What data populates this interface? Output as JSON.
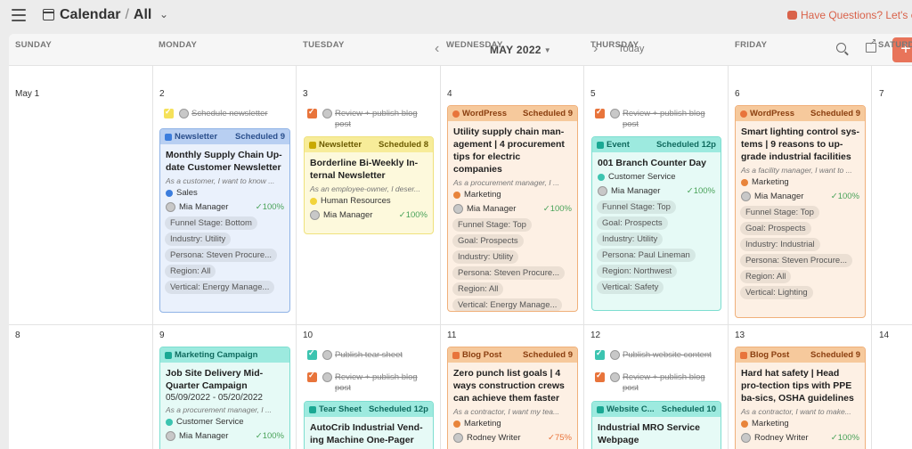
{
  "header": {
    "title": "Calendar",
    "view": "All",
    "help": "Have Questions? Let's ch"
  },
  "toolbar": {
    "month": "MAY 2022",
    "today": "Today",
    "add": "+"
  },
  "days": [
    "SUNDAY",
    "MONDAY",
    "TUESDAY",
    "WEDNESDAY",
    "THURSDAY",
    "FRIDAY",
    "SATURD"
  ],
  "dates": {
    "w1": [
      "May 1",
      "2",
      "3",
      "4",
      "5",
      "6",
      "7"
    ],
    "w2": [
      "8",
      "9",
      "10",
      "11",
      "12",
      "13",
      "14"
    ]
  },
  "tasks": {
    "mon_1": "Schedule newsletter",
    "tue_1a": "Review + publish blog",
    "tue_1b": "post",
    "thu_1a": "Review + publish blog",
    "thu_1b": "post",
    "tue_2a": "Publish tear sheet",
    "tue_2b": "Review + publish blog",
    "tue_2c": "post",
    "thu_2a": "Publish website content",
    "thu_2b": "Review + publish blog",
    "thu_2c": "post"
  },
  "cards": {
    "mon1": {
      "type": "Newsletter",
      "status": "Scheduled 9",
      "title": "Monthly Supply Chain Up-date Customer Newsletter",
      "sub": "As a customer, I want to know ...",
      "category": "Sales",
      "owner": "Mia Manager",
      "pct": "✓100%",
      "tags": [
        "Funnel Stage: Bottom",
        "Industry: Utility",
        "Persona: Steven Procure...",
        "Region: All",
        "Vertical: Energy Manage..."
      ]
    },
    "tue1": {
      "type": "Newsletter",
      "status": "Scheduled 8",
      "title": "Borderline Bi-Weekly In-ternal Newsletter",
      "sub": "As an employee-owner, I deser...",
      "category": "Human Resources",
      "owner": "Mia Manager",
      "pct": "✓100%"
    },
    "wed1": {
      "type": "WordPress",
      "status": "Scheduled 9",
      "title": "Utility supply chain man-agement | 4 procurement tips for electric companies",
      "sub": "As a procurement manager, I ...",
      "category": "Marketing",
      "owner": "Mia Manager",
      "pct": "✓100%",
      "tags": [
        "Funnel Stage: Top",
        "Goal: Prospects",
        "Industry: Utility",
        "Persona: Steven Procure...",
        "Region: All",
        "Vertical: Energy Manage..."
      ]
    },
    "thu1": {
      "type": "Event",
      "status": "Scheduled 12p",
      "title": "001 Branch Counter Day",
      "category": "Customer Service",
      "owner": "Mia Manager",
      "pct": "✓100%",
      "tags": [
        "Funnel Stage: Top",
        "Goal: Prospects",
        "Industry: Utility",
        "Persona: Paul Lineman",
        "Region: Northwest",
        "Vertical: Safety"
      ]
    },
    "fri1": {
      "type": "WordPress",
      "status": "Scheduled 9",
      "title": "Smart lighting control sys-tems | 9 reasons to up-grade industrial facilities",
      "sub": "As a facility manager, I want to ...",
      "category": "Marketing",
      "owner": "Mia Manager",
      "pct": "✓100%",
      "tags": [
        "Funnel Stage: Top",
        "Goal: Prospects",
        "Industry: Industrial",
        "Persona: Steven Procure...",
        "Region: All",
        "Vertical: Lighting"
      ]
    },
    "mon2": {
      "type": "Marketing Campaign",
      "title": "Job Site Delivery Mid-Quarter Campaign",
      "dates": "05/09/2022 - 05/20/2022",
      "sub": "As a procurement manager, I ...",
      "category": "Customer Service",
      "owner": "Mia Manager",
      "pct": "✓100%"
    },
    "tue2": {
      "type": "Tear Sheet",
      "status": "Scheduled 12p",
      "title": "AutoCrib Industrial Vend-ing Machine One-Pager"
    },
    "wed2": {
      "type": "Blog Post",
      "status": "Scheduled 9",
      "title": "Zero punch list goals | 4 ways construction crews can achieve them faster",
      "sub": "As a contractor, I want my tea...",
      "category": "Marketing",
      "owner": "Rodney Writer",
      "pct": "✓75%"
    },
    "thu2": {
      "type": "Website C...",
      "status": "Scheduled 10",
      "title": "Industrial MRO Service Webpage"
    },
    "fri2": {
      "type": "Blog Post",
      "status": "Scheduled 9",
      "title": "Hard hat safety | Head pro-tection tips with PPE ba-sics, OSHA guidelines",
      "sub": "As a contractor, I want to make...",
      "category": "Marketing",
      "owner": "Rodney Writer",
      "pct": "✓100%"
    }
  },
  "colors": {
    "accent": "#e8745a",
    "sales": "#3b7ddd",
    "hr": "#f2d43a",
    "marketing": "#e8843b",
    "customer_service": "#3cc4b0"
  }
}
